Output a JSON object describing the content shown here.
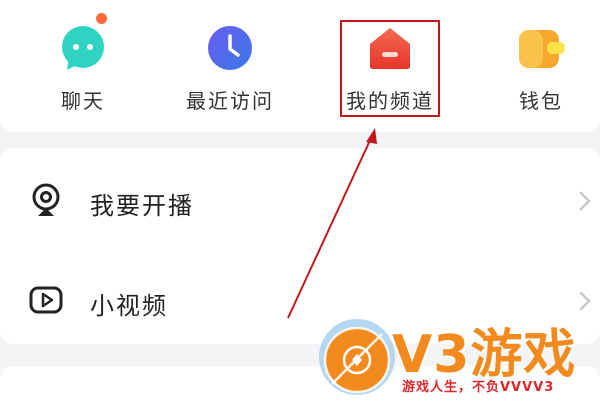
{
  "shortcuts": [
    {
      "label": "聊天",
      "icon": "chat-bubble-icon",
      "badge": true
    },
    {
      "label": "最近访问",
      "icon": "clock-icon"
    },
    {
      "label": "我的频道",
      "icon": "home-channel-icon"
    },
    {
      "label": "钱包",
      "icon": "wallet-icon"
    }
  ],
  "menu": [
    {
      "label": "我要开播",
      "icon": "live-camera-icon"
    },
    {
      "label": "小视频",
      "icon": "video-play-icon"
    }
  ],
  "watermark": {
    "brand": "V3游戏",
    "slogan": "游戏人生，不负VVVV3"
  },
  "colors": {
    "highlight": "#c0161c",
    "chat": "#2fd3c2",
    "clock": "#4c63e8",
    "channel": "#f04a3c",
    "wallet": "#f7a72c",
    "badge": "#ff6a3a",
    "watermark_orange": "#f28a1e",
    "watermark_red": "#e0262a"
  }
}
